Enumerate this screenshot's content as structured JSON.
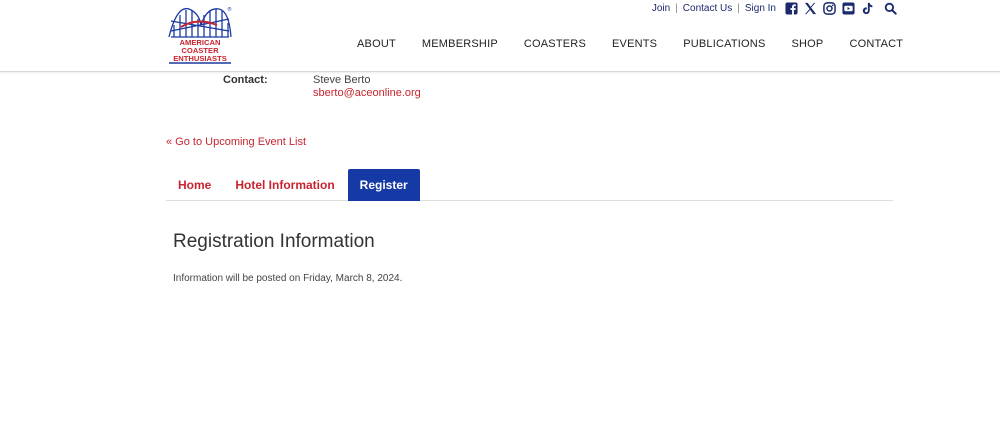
{
  "logo": {
    "text_line1": "AMERICAN",
    "text_line2": "COASTER",
    "text_line3": "ENTHUSIASTS",
    "mark": "®"
  },
  "utility": {
    "join": "Join",
    "contact_us": "Contact Us",
    "sign_in": "Sign In",
    "separator": "|"
  },
  "social_icons": [
    "facebook-icon",
    "x-icon",
    "instagram-icon",
    "youtube-icon",
    "tiktok-icon",
    "search-icon"
  ],
  "nav": {
    "items": [
      {
        "label": "ABOUT"
      },
      {
        "label": "MEMBERSHIP"
      },
      {
        "label": "COASTERS"
      },
      {
        "label": "EVENTS"
      },
      {
        "label": "PUBLICATIONS"
      },
      {
        "label": "SHOP"
      },
      {
        "label": "CONTACT"
      }
    ]
  },
  "contact": {
    "label": "Contact:",
    "name": "Steve Berto",
    "email": "sberto@aceonline.org"
  },
  "back_link": "« Go to Upcoming Event List",
  "tabs": [
    {
      "label": "Home",
      "active": false
    },
    {
      "label": "Hotel Information",
      "active": false
    },
    {
      "label": "Register",
      "active": true
    }
  ],
  "registration": {
    "title": "Registration Information",
    "text": "Information will be posted on Friday, March 8, 2024."
  },
  "colors": {
    "brand_navy": "#1a2a6c",
    "brand_red": "#c8242f",
    "tab_active": "#1539a5"
  }
}
